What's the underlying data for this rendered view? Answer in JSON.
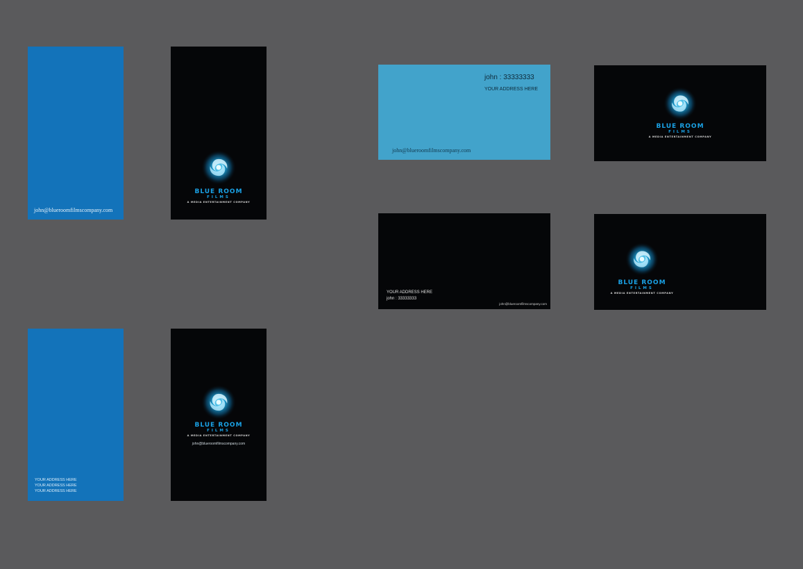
{
  "colors": {
    "background": "#5a5a5c",
    "card_blue_dark": "#1373ba",
    "card_blue_light": "#42a3cb",
    "card_black": "#050608",
    "brand_blue": "#1aa2e6"
  },
  "logo": {
    "icon": "swirl-logo-icon",
    "line1": "BLUE ROOM",
    "line2": "FILMS",
    "tagline": "A MEDIA ENTERTAINMENT COMPANY"
  },
  "cards": {
    "vertical_blue_1": {
      "email": "john@blueroomfilmscompany.com"
    },
    "vertical_blue_2": {
      "address_lines": [
        "YOUR ADDRESS HERE",
        "YOUR ADDRESS HERE",
        "YOUR ADDRESS HERE"
      ]
    },
    "vertical_black_2": {
      "email": "john@blueroomfilmscompany.com"
    },
    "horizontal_light": {
      "phone": "john : 33333333",
      "address": "YOUR ADDRESS HERE",
      "email": "john@blueroomfilmscompany.com"
    },
    "horizontal_black_info": {
      "address": "YOUR ADDRESS HERE",
      "phone": "john : 33333333",
      "email": "john@blueroomfilmscompany.com"
    }
  }
}
